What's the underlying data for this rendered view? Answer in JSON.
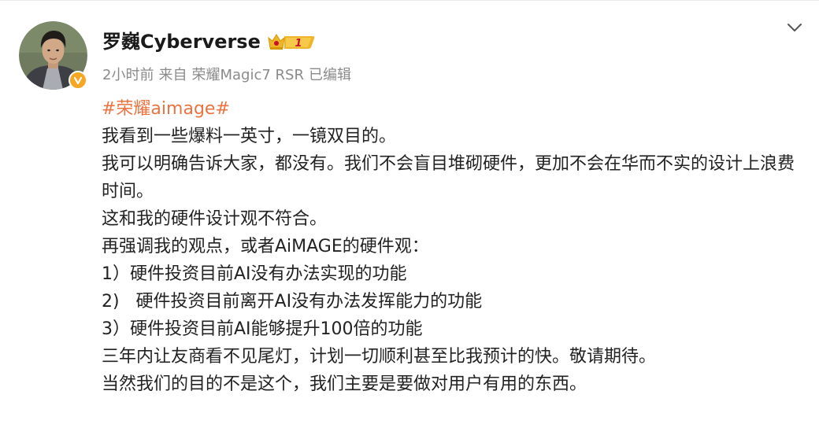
{
  "post": {
    "username": "罗巍Cyberverse",
    "vip_level": "1",
    "meta": {
      "time": "2小时前",
      "source_prefix": "来自",
      "device": "荣耀Magic7 RSR",
      "edited": "已编辑"
    },
    "hashtag": "#荣耀aimage#",
    "lines": [
      "我看到一些爆料一英寸，一镜双目的。",
      "我可以明确告诉大家，都没有。我们不会盲目堆砌硬件，更加不会在华而不实的设计上浪费时间。",
      "这和我的硬件设计观不符合。",
      "再强调我的观点，或者AiMAGE的硬件观：",
      "1）硬件投资目前AI没有办法实现的功能",
      "2)   硬件投资目前离开AI没有办法发挥能力的功能",
      "3）硬件投资目前AI能够提升100倍的功能",
      "三年内让友商看不见尾灯，计划一切顺利甚至比我预计的快。敬请期待。",
      "当然我们的目的不是这个，我们主要是要做对用户有用的东西。"
    ]
  },
  "colors": {
    "hashtag": "#eb7340",
    "meta_text": "#8a8a8a",
    "verified_badge": "#f5a623",
    "vip_badge": "#f0b429"
  },
  "icons": {
    "verified": "verified-v-icon",
    "vip": "crown-vip-icon",
    "menu": "chevron-down-icon"
  }
}
